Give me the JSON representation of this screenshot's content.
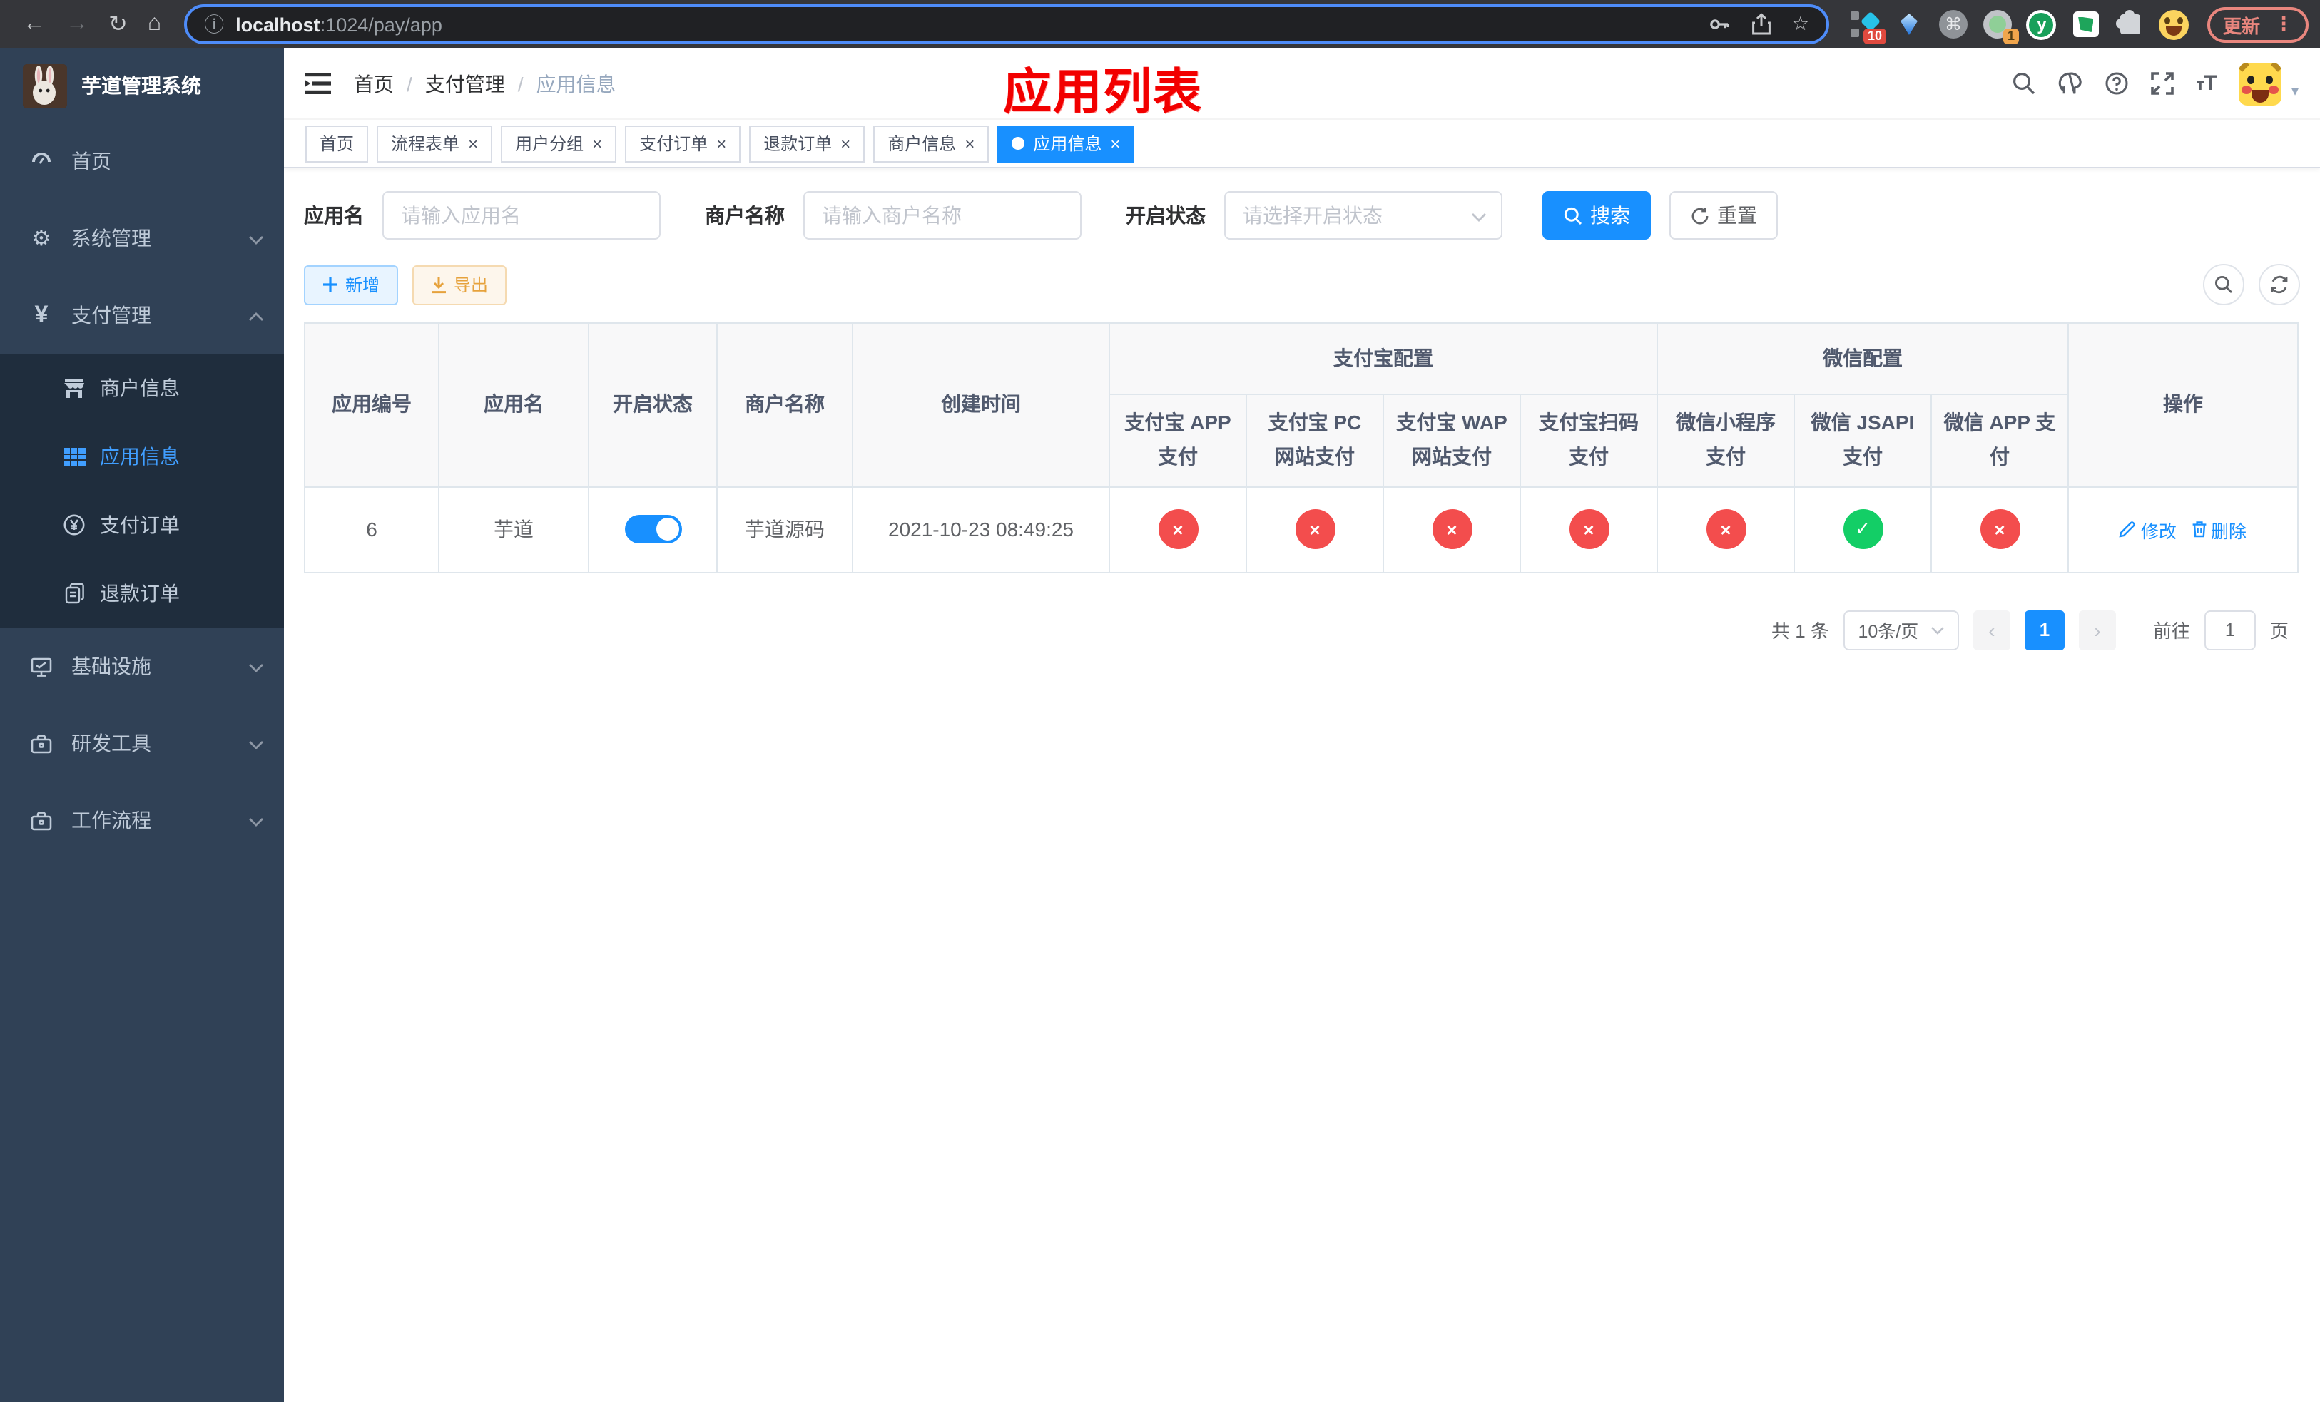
{
  "colors": {
    "accent": "#1890ff",
    "sidebar_bg": "#304156",
    "submenu_bg": "#1f2d3d",
    "success": "#13ce66",
    "danger": "#f34d4d",
    "warning": "#e6a23c",
    "title_red": "#f20000"
  },
  "icons": {
    "back": "←",
    "forward": "→",
    "reload": "↻",
    "home": "⌂",
    "info": "ⓘ",
    "star": "☆",
    "dots": "⋮",
    "command": "⌘",
    "sep": "/",
    "yen": "¥",
    "gear": "⚙",
    "plus": "＋",
    "cross": "×",
    "check": "✓",
    "prev": "‹",
    "next": "›",
    "caret_down": "▾",
    "font_small": "т",
    "font_big": "T",
    "yuque_y": "y"
  },
  "browser": {
    "url_host": "localhost",
    "url_path": ":1024/pay/app",
    "update_label": "更新",
    "ext_badge_pin": "10",
    "ext_badge_profile": "1"
  },
  "sidebar": {
    "title": "芋道管理系统",
    "menu": [
      {
        "label": "首页"
      },
      {
        "label": "系统管理"
      },
      {
        "label": "支付管理"
      },
      {
        "label": "商户信息"
      },
      {
        "label": "应用信息"
      },
      {
        "label": "支付订单"
      },
      {
        "label": "退款订单"
      },
      {
        "label": "基础设施"
      },
      {
        "label": "研发工具"
      },
      {
        "label": "工作流程"
      }
    ]
  },
  "header": {
    "breadcrumb": [
      "首页",
      "支付管理",
      "应用信息"
    ],
    "page_title": "应用列表"
  },
  "tabs": [
    {
      "label": "首页"
    },
    {
      "label": "流程表单"
    },
    {
      "label": "用户分组"
    },
    {
      "label": "支付订单"
    },
    {
      "label": "退款订单"
    },
    {
      "label": "商户信息"
    },
    {
      "label": "应用信息"
    }
  ],
  "filters": {
    "app_name_label": "应用名",
    "app_name_placeholder": "请输入应用名",
    "merchant_label": "商户名称",
    "merchant_placeholder": "请输入商户名称",
    "status_label": "开启状态",
    "status_placeholder": "请选择开启状态",
    "search_label": "搜索",
    "reset_label": "重置"
  },
  "toolbar": {
    "add_label": "新增",
    "export_label": "导出"
  },
  "table": {
    "columns": [
      "应用编号",
      "应用名",
      "开启状态",
      "商户名称",
      "创建时间"
    ],
    "group_alipay": "支付宝配置",
    "group_wechat": "微信配置",
    "sub_columns": [
      "支付宝 APP 支付",
      "支付宝 PC 网站支付",
      "支付宝 WAP 网站支付",
      "支付宝扫码支付",
      "微信小程序支付",
      "微信 JSAPI 支付",
      "微信 APP 支付"
    ],
    "action_col": "操作",
    "rows": [
      {
        "id": "6",
        "name": "芋道",
        "enabled": true,
        "merchant": "芋道源码",
        "created": "2021-10-23 08:49:25",
        "channels": [
          false,
          false,
          false,
          false,
          false,
          true,
          false
        ],
        "edit_label": "修改",
        "delete_label": "删除"
      }
    ]
  },
  "pagination": {
    "total": "共 1 条",
    "page_size": "10条/页",
    "page": "1",
    "goto_label": "前往",
    "goto_value": "1",
    "page_unit": "页"
  }
}
